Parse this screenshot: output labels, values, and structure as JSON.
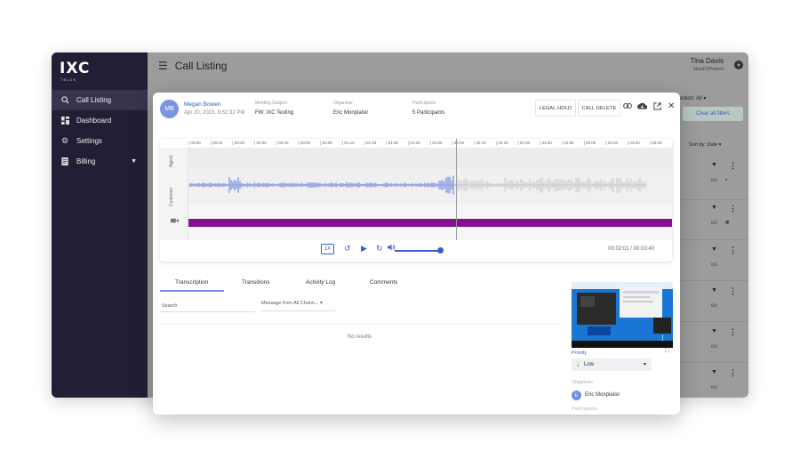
{
  "app": {
    "logo": "IXC",
    "logo_sub": "TELUS",
    "page_title": "Call Listing",
    "user": {
      "name": "Tina Davis",
      "sub": "Mand12Prosnd"
    }
  },
  "sidebar": {
    "items": [
      {
        "label": "Call Listing",
        "icon": "search-icon"
      },
      {
        "label": "Dashboard",
        "icon": "dashboard-icon"
      },
      {
        "label": "Settings",
        "icon": "gear-icon"
      },
      {
        "label": "Billing",
        "icon": "billing-icon"
      }
    ]
  },
  "filters": {
    "direction": "rection: All",
    "clear_label": "Clear all filters",
    "sort_by": "Sort by: Date"
  },
  "modal": {
    "avatar_initials": "MB",
    "caller_name": "Megan Bowen",
    "date": "Apr 20, 2023, 9:52:32 PM",
    "meeting_subject_label": "Meeting Subject",
    "meeting_subject": "FW: IXC Testing",
    "organizer_label": "Organizer",
    "organizer": "Eric Monplaisir",
    "participants_label": "Participants",
    "participants": "5 Participants",
    "legal_hold_label": "LEGAL HOLD",
    "call_delete_label": "CALL DELETE"
  },
  "player": {
    "ticks": [
      "00:00",
      "00:10",
      "00:20",
      "00:30",
      "00:40",
      "00:50",
      "01:00",
      "01:10",
      "01:20",
      "01:30",
      "01:40",
      "01:50",
      "02:00",
      "02:10",
      "02:20",
      "02:30",
      "02:40",
      "02:50",
      "03:00",
      "03:10",
      "03:20",
      "03:30"
    ],
    "lanes": {
      "agent": "Agent",
      "customer": "Customer"
    },
    "speed": "1X",
    "time": "00:02:01 / 00:03:40",
    "progress_fraction": 0.55,
    "volume_fraction": 1.0,
    "video_bar_color": "#86118f",
    "accent_color": "#3b5bd6"
  },
  "tabs": [
    "Transcription",
    "Transitions",
    "Activity Log",
    "Comments"
  ],
  "transcript": {
    "search_placeholder": "Search",
    "message_filter": "Message from All Chann...",
    "no_results": "No results"
  },
  "details": {
    "priority_label": "Priority",
    "priority_value": "Low",
    "organizer_label": "Organizer",
    "organizer_initial": "E",
    "organizer_name": "Eric Monplaisir",
    "participants_label": "Participants"
  }
}
